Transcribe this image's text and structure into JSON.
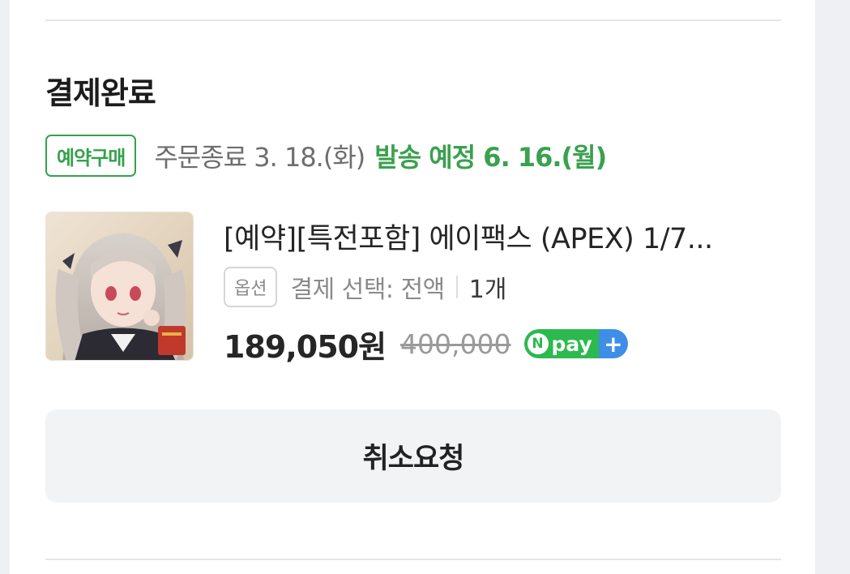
{
  "order": {
    "status_title": "결제완료",
    "preorder_badge": "예약구매",
    "order_end": "주문종료 3. 18.(화)",
    "ship_date": "발송 예정 6. 16.(월)"
  },
  "product": {
    "name": "[예약][특전포함] 에이팩스 (APEX) 1/7...",
    "option_badge": "옵션",
    "option_text": "결제 선택: 전액",
    "quantity": "1개",
    "price": "189,050원",
    "original_price": "400,000",
    "pay_badge": {
      "n": "N",
      "text": "pay",
      "plus": "+"
    }
  },
  "actions": {
    "cancel_request": "취소요청"
  },
  "colors": {
    "accent_green": "#35a14d",
    "npay_green": "#2cb94e",
    "npay_blue": "#3f8ee6"
  }
}
